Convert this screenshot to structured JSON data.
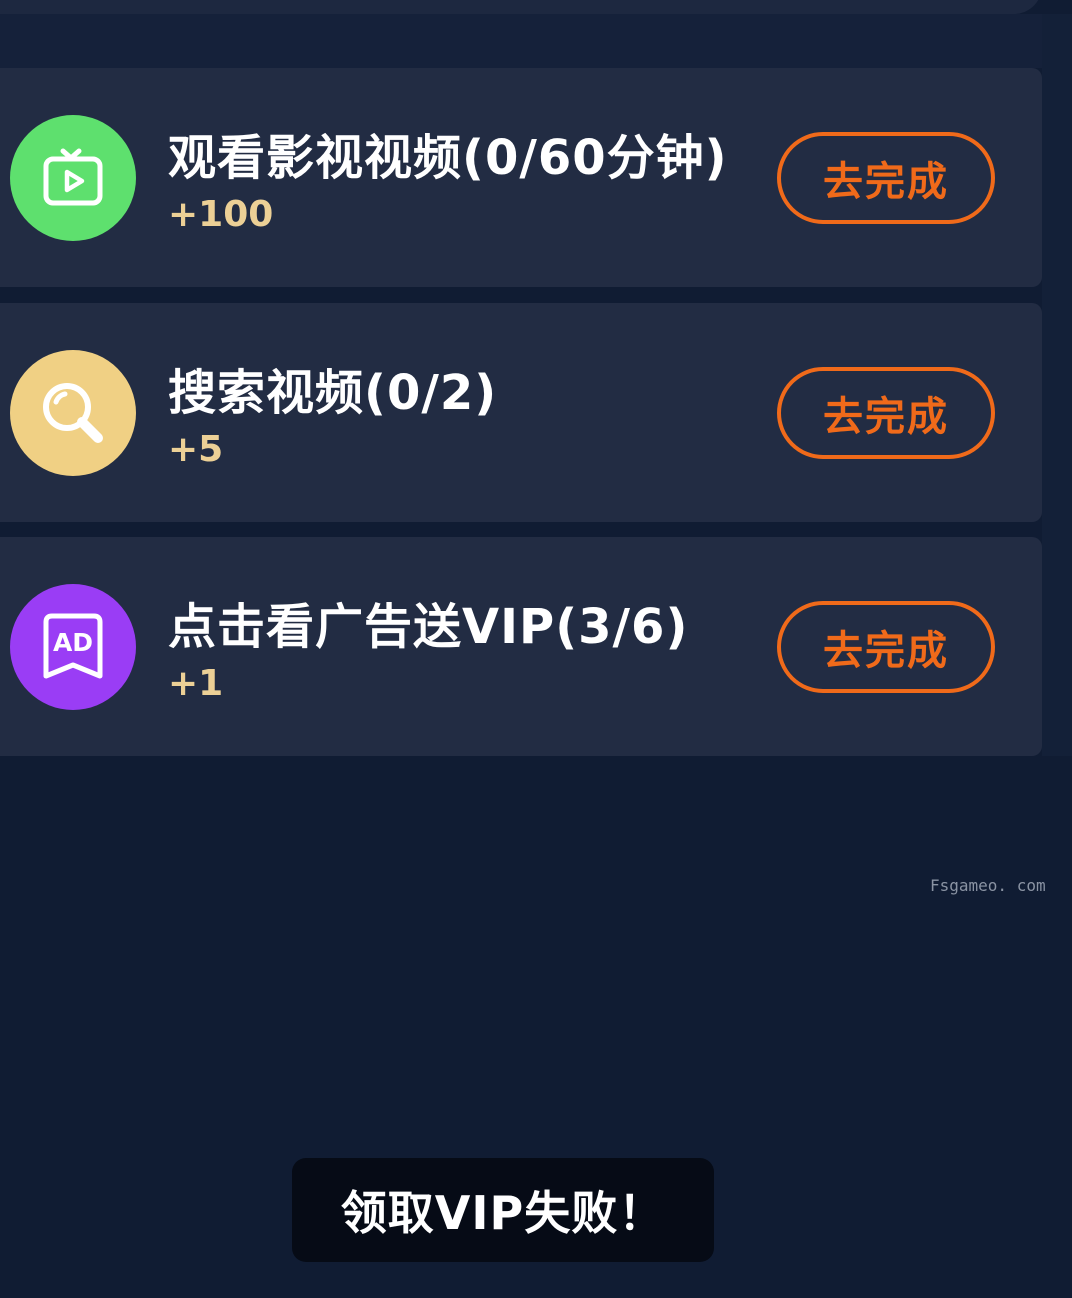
{
  "tasks": [
    {
      "title": "观看影视视频(0/60分钟)",
      "reward": "+100",
      "button_label": "去完成",
      "icon": "tv-play-icon",
      "icon_color": "#5ee06e"
    },
    {
      "title": "搜索视频(0/2)",
      "reward": "+5",
      "button_label": "去完成",
      "icon": "search-icon",
      "icon_color": "#f0d084"
    },
    {
      "title": "点击看广告送VIP(3/6)",
      "reward": "+1",
      "button_label": "去完成",
      "icon": "ad-icon",
      "icon_color": "#9a3df5",
      "icon_text": "AD"
    }
  ],
  "watermark": "Fsgameo. com",
  "toast": {
    "message": "领取VIP失败！"
  },
  "colors": {
    "background": "#101c33",
    "card": "#222c43",
    "accent": "#f06a1a",
    "reward": "#ecd096"
  }
}
